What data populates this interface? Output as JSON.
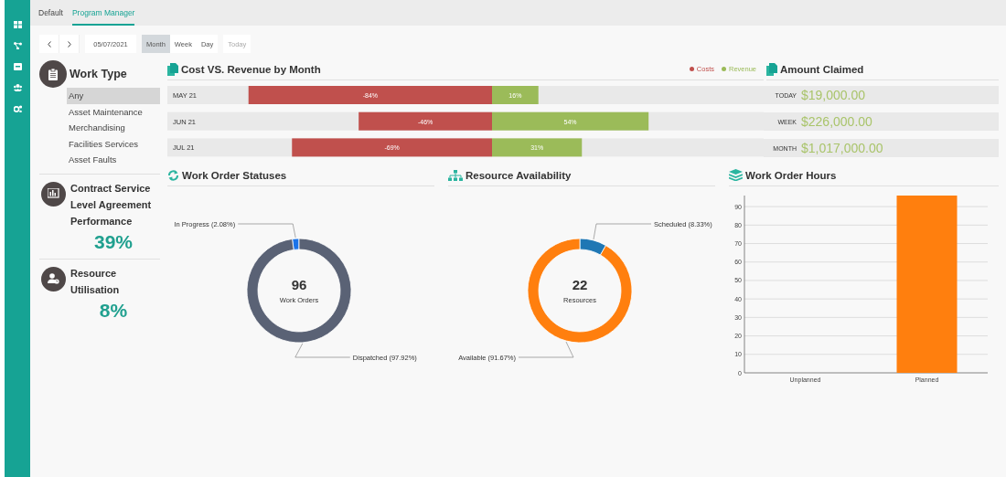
{
  "tabs": [
    {
      "label": "Default",
      "selected": false
    },
    {
      "label": "Program Manager",
      "selected": true
    }
  ],
  "toolbar": {
    "date": "05/07/2021",
    "views": [
      {
        "label": "Month",
        "selected": true
      },
      {
        "label": "Week",
        "selected": false
      },
      {
        "label": "Day",
        "selected": false
      }
    ],
    "today": {
      "label": "Today",
      "disabled": true
    }
  },
  "work_type": {
    "title": "Work Type",
    "items": [
      {
        "label": "Any",
        "selected": true
      },
      {
        "label": "Asset Maintenance",
        "selected": false
      },
      {
        "label": "Merchandising",
        "selected": false
      },
      {
        "label": "Facilities Services",
        "selected": false
      },
      {
        "label": "Asset Faults",
        "selected": false
      }
    ]
  },
  "kpis": [
    {
      "kind": "chart",
      "title": "Contract Service Level Agreement Performance",
      "value": "39%"
    },
    {
      "kind": "user",
      "title": "Resource Utilisation",
      "value": "8%"
    }
  ],
  "cost_revenue": {
    "title": "Cost VS. Revenue by Month",
    "chart_data": {
      "type": "bar",
      "orientation": "horizontal",
      "stacked": true,
      "categories": [
        "MAY 21",
        "JUN 21",
        "JUL 21"
      ],
      "series": [
        {
          "name": "Costs",
          "color": "#c0504d",
          "values": [
            -84,
            -46,
            -69
          ],
          "value_labels": [
            "-84%",
            "-46%",
            "-69%"
          ]
        },
        {
          "name": "Revenue",
          "color": "#9bbb59",
          "values": [
            16,
            54,
            31
          ],
          "value_labels": [
            "16%",
            "54%",
            "31%"
          ]
        }
      ]
    }
  },
  "amount_claimed": {
    "title": "Amount Claimed",
    "rows": [
      {
        "label": "TODAY",
        "value": "$19,000.00"
      },
      {
        "label": "WEEK",
        "value": "$226,000.00"
      },
      {
        "label": "MONTH",
        "value": "$1,017,000.00"
      }
    ]
  },
  "work_order_statuses": {
    "title": "Work Order Statuses",
    "total": "96",
    "total_label": "Work Orders",
    "chart_data": {
      "type": "donut",
      "categories": [
        "In Progress (2.08%)",
        "Dispatched (97.92%)"
      ],
      "values": [
        2.08,
        97.92
      ],
      "colors": [
        "#1a73e8",
        "#5a6275"
      ]
    }
  },
  "resource_availability": {
    "title": "Resource Availability",
    "total": "22",
    "total_label": "Resources",
    "chart_data": {
      "type": "donut",
      "categories": [
        "Scheduled (8.33%)",
        "Available (91.67%)"
      ],
      "values": [
        8.33,
        91.67
      ],
      "colors": [
        "#1f77b4",
        "#ff7f0e"
      ]
    }
  },
  "work_order_hours": {
    "title": "Work Order Hours",
    "chart_data": {
      "type": "bar",
      "categories": [
        "Unplanned",
        "Planned"
      ],
      "values": [
        0,
        96
      ],
      "color": "#ff7f0e",
      "ylim": [
        0,
        96
      ],
      "yticks": [
        0,
        10,
        20,
        30,
        40,
        50,
        60,
        70,
        80,
        90
      ],
      "grid": true
    }
  }
}
